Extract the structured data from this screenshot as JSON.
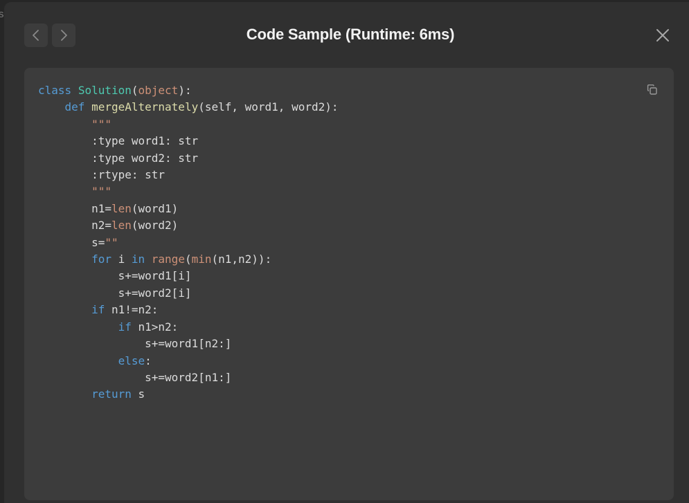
{
  "background": {
    "partial_text": "s"
  },
  "dialog": {
    "title": "Code Sample (Runtime: 6ms)",
    "nav": {
      "prev_icon": "chevron-left-icon",
      "next_icon": "chevron-right-icon"
    },
    "close_icon": "close-icon",
    "copy_icon": "copy-icon"
  },
  "code": {
    "language": "python",
    "lines": [
      [
        [
          "kw",
          "class"
        ],
        [
          "p",
          " "
        ],
        [
          "cls",
          "Solution"
        ],
        [
          "p",
          "("
        ],
        [
          "bi",
          "object"
        ],
        [
          "p",
          "):"
        ]
      ],
      [
        [
          "p",
          "    "
        ],
        [
          "kw",
          "def"
        ],
        [
          "p",
          " "
        ],
        [
          "fn",
          "mergeAlternately"
        ],
        [
          "p",
          "(self, word1, word2):"
        ]
      ],
      [
        [
          "p",
          "        "
        ],
        [
          "str",
          "\"\"\""
        ]
      ],
      [
        [
          "p",
          "        :type word1: str"
        ]
      ],
      [
        [
          "p",
          "        :type word2: str"
        ]
      ],
      [
        [
          "p",
          "        :rtype: str"
        ]
      ],
      [
        [
          "p",
          "        "
        ],
        [
          "str",
          "\"\"\""
        ]
      ],
      [
        [
          "p",
          "        n1="
        ],
        [
          "bi",
          "len"
        ],
        [
          "p",
          "(word1)"
        ]
      ],
      [
        [
          "p",
          "        n2="
        ],
        [
          "bi",
          "len"
        ],
        [
          "p",
          "(word2)"
        ]
      ],
      [
        [
          "p",
          "        s="
        ],
        [
          "str",
          "\"\""
        ]
      ],
      [
        [
          "p",
          "        "
        ],
        [
          "kw",
          "for"
        ],
        [
          "p",
          " i "
        ],
        [
          "kw",
          "in"
        ],
        [
          "p",
          " "
        ],
        [
          "bi",
          "range"
        ],
        [
          "p",
          "("
        ],
        [
          "bi",
          "min"
        ],
        [
          "p",
          "(n1,n2)):"
        ]
      ],
      [
        [
          "p",
          "            s+=word1[i]"
        ]
      ],
      [
        [
          "p",
          "            s+=word2[i]"
        ]
      ],
      [
        [
          "p",
          "        "
        ],
        [
          "kw",
          "if"
        ],
        [
          "p",
          " n1!=n2:"
        ]
      ],
      [
        [
          "p",
          "            "
        ],
        [
          "kw",
          "if"
        ],
        [
          "p",
          " n1>n2:"
        ]
      ],
      [
        [
          "p",
          "                s+=word1[n2:]"
        ]
      ],
      [
        [
          "p",
          "            "
        ],
        [
          "kw",
          "else"
        ],
        [
          "p",
          ":"
        ]
      ],
      [
        [
          "p",
          "                s+=word2[n1:]"
        ]
      ],
      [
        [
          "p",
          "        "
        ],
        [
          "kw",
          "return"
        ],
        [
          "p",
          " s"
        ]
      ]
    ]
  },
  "colors": {
    "keyword": "#569cd6",
    "class_name": "#4ec9b0",
    "function_name": "#dcdcaa",
    "builtin": "#ce9178",
    "string": "#ce9178",
    "plain": "#dcdcdc"
  }
}
